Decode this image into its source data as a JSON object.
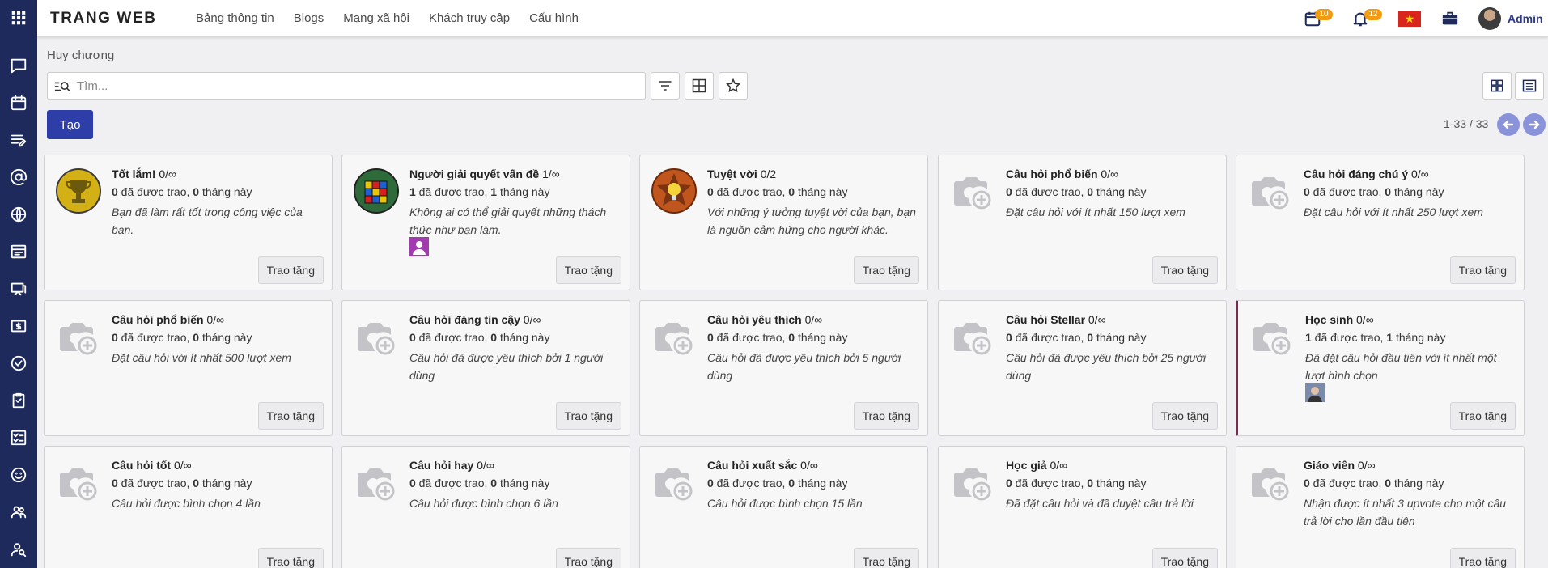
{
  "topbar": {
    "brand": "TRANG WEB",
    "menu": [
      "Bảng thông tin",
      "Blogs",
      "Mạng xã hội",
      "Khách truy cập",
      "Cấu hình"
    ],
    "calendar_count": "10",
    "notification_count": "12",
    "user": "Admin"
  },
  "breadcrumb": "Huy chương",
  "search": {
    "placeholder": "Tìm..."
  },
  "create_label": "Tạo",
  "pager": "1-33 / 33",
  "award_label": "Trao tặng",
  "cards": [
    {
      "name": "Tốt lắm!",
      "suffix": " 0/∞",
      "granted": "0",
      "granted_label": " đã được trao, ",
      "month": "0",
      "month_label": " tháng này",
      "desc": "Bạn đã làm rất tốt trong công việc của bạn.",
      "icon": "trophy-icon"
    },
    {
      "name": "Người giải quyết vấn đề",
      "suffix": " 1/∞",
      "granted": "1",
      "granted_label": " đã được trao, ",
      "month": "1",
      "month_label": " tháng này",
      "desc": "Không ai có thể giải quyết những thách thức như bạn làm.",
      "icon": "rubik-cube-icon"
    },
    {
      "name": "Tuyệt vời",
      "suffix": " 0/2",
      "granted": "0",
      "granted_label": " đã được trao, ",
      "month": "0",
      "month_label": " tháng này",
      "desc": "Với những ý tưởng tuyệt vời của bạn, bạn là nguồn cảm hứng cho người khác.",
      "icon": "lightbulb-star-icon"
    },
    {
      "name": "Câu hỏi phổ biến",
      "suffix": " 0/∞",
      "granted": "0",
      "granted_label": " đã được trao, ",
      "month": "0",
      "month_label": " tháng này",
      "desc": "Đặt câu hỏi với ít nhất 150 lượt xem",
      "icon": "camera-plus-icon"
    },
    {
      "name": "Câu hỏi đáng chú ý",
      "suffix": " 0/∞",
      "granted": "0",
      "granted_label": " đã được trao, ",
      "month": "0",
      "month_label": " tháng này",
      "desc": "Đặt câu hỏi với ít nhất 250 lượt xem",
      "icon": "camera-plus-icon"
    },
    {
      "name": "Câu hỏi phổ biến",
      "suffix": " 0/∞",
      "granted": "0",
      "granted_label": " đã được trao, ",
      "month": "0",
      "month_label": " tháng này",
      "desc": "Đặt câu hỏi với ít nhất 500 lượt xem",
      "icon": "camera-plus-icon"
    },
    {
      "name": "Câu hỏi đáng tin cậy",
      "suffix": " 0/∞",
      "granted": "0",
      "granted_label": " đã được trao, ",
      "month": "0",
      "month_label": " tháng này",
      "desc": "Câu hỏi đã được yêu thích bởi 1 người dùng",
      "icon": "camera-plus-icon"
    },
    {
      "name": "Câu hỏi yêu thích",
      "suffix": " 0/∞",
      "granted": "0",
      "granted_label": " đã được trao, ",
      "month": "0",
      "month_label": " tháng này",
      "desc": "Câu hỏi đã được yêu thích bởi 5 người dùng",
      "icon": "camera-plus-icon"
    },
    {
      "name": "Câu hỏi Stellar",
      "suffix": " 0/∞",
      "granted": "0",
      "granted_label": " đã được trao, ",
      "month": "0",
      "month_label": " tháng này",
      "desc": "Câu hỏi đã được yêu thích bởi 25 người dùng",
      "icon": "camera-plus-icon"
    },
    {
      "name": "Học sinh",
      "suffix": " 0/∞",
      "granted": "1",
      "granted_label": " đã được trao, ",
      "month": "1",
      "month_label": " tháng này",
      "desc": "Đã đặt câu hỏi đầu tiên với ít nhất một lượt bình chọn",
      "icon": "camera-plus-icon"
    },
    {
      "name": "Câu hỏi tốt",
      "suffix": " 0/∞",
      "granted": "0",
      "granted_label": " đã được trao, ",
      "month": "0",
      "month_label": " tháng này",
      "desc": "Câu hỏi được bình chọn 4 lần",
      "icon": "camera-plus-icon"
    },
    {
      "name": "Câu hỏi hay",
      "suffix": " 0/∞",
      "granted": "0",
      "granted_label": " đã được trao, ",
      "month": "0",
      "month_label": " tháng này",
      "desc": "Câu hỏi được bình chọn 6 lần",
      "icon": "camera-plus-icon"
    },
    {
      "name": "Câu hỏi xuất sắc",
      "suffix": " 0/∞",
      "granted": "0",
      "granted_label": " đã được trao, ",
      "month": "0",
      "month_label": " tháng này",
      "desc": "Câu hỏi được bình chọn 15 lần",
      "icon": "camera-plus-icon"
    },
    {
      "name": "Học giả",
      "suffix": " 0/∞",
      "granted": "0",
      "granted_label": " đã được trao, ",
      "month": "0",
      "month_label": " tháng này",
      "desc": "Đã đặt câu hỏi và đã duyệt câu trả lời",
      "icon": "camera-plus-icon"
    },
    {
      "name": "Giáo viên",
      "suffix": " 0/∞",
      "granted": "0",
      "granted_label": " đã được trao, ",
      "month": "0",
      "month_label": " tháng này",
      "desc": "Nhận được ít nhất 3 upvote cho một câu trả lời cho lần đầu tiên",
      "icon": "camera-plus-icon"
    }
  ],
  "colors": {
    "sidebar": "#1f2a5c",
    "primary": "#2e3ea8",
    "badge": "#f39c12",
    "selected_border": "#7a2b4f"
  }
}
